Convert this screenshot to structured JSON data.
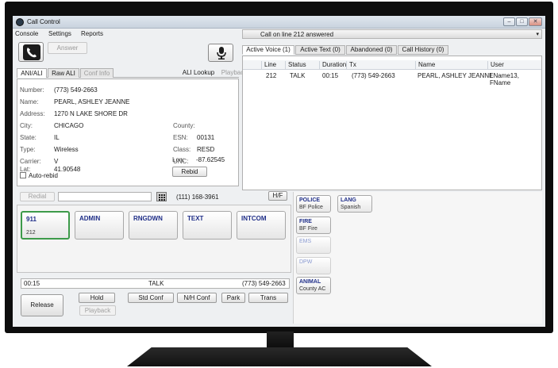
{
  "window": {
    "title": "Call Control",
    "min": "–",
    "max": "□",
    "close": "✕"
  },
  "menu": {
    "console": "Console",
    "settings": "Settings",
    "reports": "Reports"
  },
  "call_status": {
    "text": "Call on line 212 answered",
    "arrow": "▾"
  },
  "phone": {
    "answer": "Answer",
    "phone_icon": "phone-icon",
    "mic_icon": "microphone-icon"
  },
  "ali_tabs": [
    {
      "label": "ANI/ALI"
    },
    {
      "label": "Raw ALI"
    },
    {
      "label": "Conf Info"
    },
    {
      "label": "ALI Lookup"
    },
    {
      "label": "Playback"
    }
  ],
  "ali": {
    "number_label": "Number:",
    "number": "(773) 549-2663",
    "name_label": "Name:",
    "name": "PEARL, ASHLEY JEANNE",
    "address_label": "Address:",
    "address": "1270 N LAKE SHORE DR",
    "city_label": "City:",
    "city": "CHICAGO",
    "county_label": "County:",
    "county": "",
    "state_label": "State:",
    "state": "IL",
    "esn_label": "ESN:",
    "esn": "00131",
    "type_label": "Type:",
    "type": "Wireless",
    "class_label": "Class:",
    "class": "RESD",
    "carrier_label": "Carrier:",
    "carrier": "V",
    "unc_label": "UNC:",
    "unc": "",
    "lat_label": "Lat:",
    "lat": "41.90548",
    "lon_label": "Lon:",
    "lon": "-87.62545",
    "autorebid": "Auto-rebid",
    "rebid": "Rebid"
  },
  "right_tabs": [
    {
      "label": "Active Voice (1)"
    },
    {
      "label": "Active Text (0)"
    },
    {
      "label": "Abandoned (0)"
    },
    {
      "label": "Call History (0)"
    }
  ],
  "grid": {
    "columns": [
      "Line",
      "Status",
      "Duration",
      "Tx",
      "Name",
      "User"
    ],
    "rows": [
      [
        "212",
        "TALK",
        "00:15",
        "(773) 549-2663",
        "PEARL, ASHLEY JEANNE",
        "LName13, FName"
      ]
    ]
  },
  "dialer": {
    "redial": "Redial",
    "input": "",
    "last_number": "(111) 168-3961",
    "hf": "H/F"
  },
  "lines": [
    {
      "name": "911",
      "sub": "212"
    },
    {
      "name": "ADMIN",
      "sub": ""
    },
    {
      "name": "RNGDWN",
      "sub": ""
    },
    {
      "name": "TEXT",
      "sub": ""
    },
    {
      "name": "INTCOM",
      "sub": ""
    }
  ],
  "status": {
    "duration": "00:15",
    "state": "TALK",
    "number": "(773) 549-2663"
  },
  "actions": {
    "release": "Release",
    "hold": "Hold",
    "std_conf": "Std Conf",
    "nh_conf": "N/H Conf",
    "park": "Park",
    "trans": "Trans",
    "playback": "Playback"
  },
  "speed_dial": [
    {
      "name": "POLICE",
      "sub": "BF Police"
    },
    {
      "name": "LANG",
      "sub": "Spanish"
    },
    {
      "name": "FIRE",
      "sub": "BF Fire"
    },
    {
      "name": "EMS",
      "sub": ""
    },
    {
      "name": "DPW",
      "sub": ""
    },
    {
      "name": "ANIMAL",
      "sub": "County AC"
    }
  ],
  "colors": {
    "active_line_border": "#3d9a4a",
    "button_label": "#1f2e88"
  }
}
